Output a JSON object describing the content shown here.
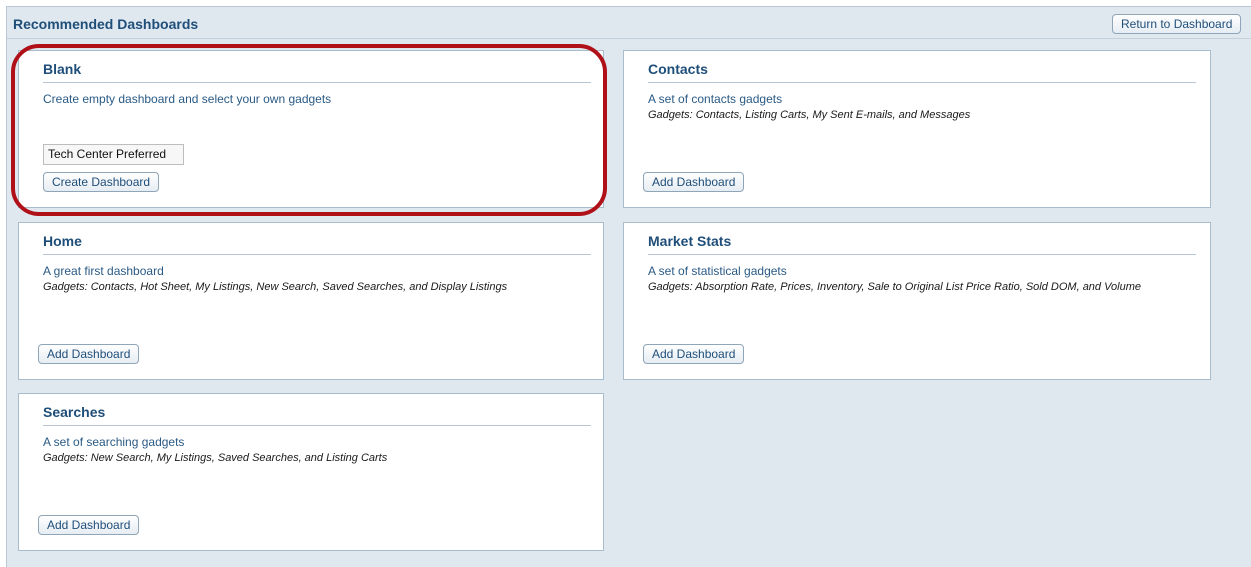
{
  "header": {
    "title": "Recommended Dashboards",
    "return_label": "Return to Dashboard"
  },
  "cards": [
    {
      "title": "Blank",
      "description": "Create empty dashboard and select your own gadgets",
      "gadgets": "",
      "select_value": "Tech Center Preferred",
      "button_label": "Create Dashboard"
    },
    {
      "title": "Contacts",
      "description": "A set of contacts gadgets",
      "gadgets": "Gadgets: Contacts, Listing Carts, My Sent E-mails, and Messages",
      "button_label": "Add Dashboard"
    },
    {
      "title": "Home",
      "description": "A great first dashboard",
      "gadgets": "Gadgets: Contacts, Hot Sheet, My Listings, New Search, Saved Searches, and Display Listings",
      "button_label": "Add Dashboard"
    },
    {
      "title": "Market Stats",
      "description": "A set of statistical gadgets",
      "gadgets": "Gadgets: Absorption Rate, Prices, Inventory, Sale to Original List Price Ratio, Sold DOM, and Volume",
      "button_label": "Add Dashboard"
    },
    {
      "title": "Searches",
      "description": "A set of searching gadgets",
      "gadgets": "Gadgets: New Search, My Listings, Saved Searches, and Listing Carts",
      "button_label": "Add Dashboard"
    }
  ],
  "colors": {
    "background": "#dfe8ef",
    "heading": "#1f4e79",
    "highlight": "#b01119"
  }
}
